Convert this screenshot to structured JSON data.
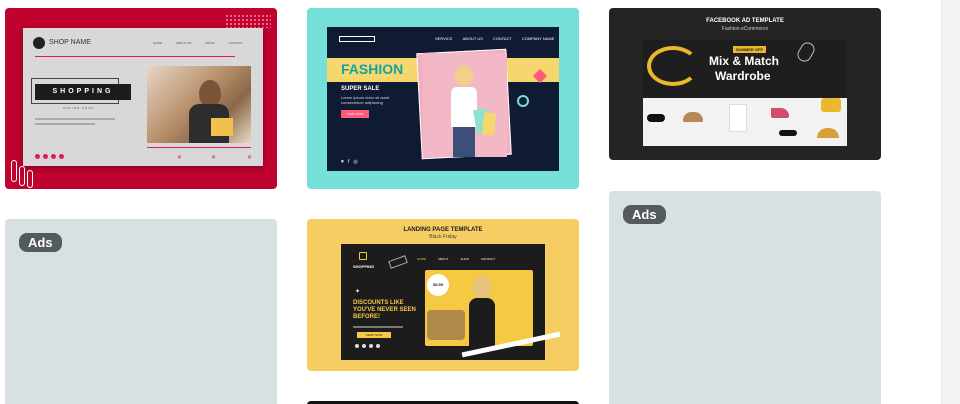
{
  "cards": {
    "shop": {
      "shop_name": "SHOP NAME",
      "nav": [
        "HOME",
        "ABOUT US",
        "PRICE",
        "CONTACT"
      ],
      "title": "SHOPPING",
      "subtitle": "ONLINE SHOP",
      "colors": {
        "frame": "#c0022f",
        "panel": "#d8d8d8",
        "accent": "#e01a4f"
      }
    },
    "fashion": {
      "nav": [
        "SERVICE",
        "ABOUT US",
        "CONTACT",
        "COMPANY NAME"
      ],
      "title": "FASHION",
      "sale": "SUPER SALE",
      "body": "Lorem ipsum dolor sit amet consectetuer adipiscing",
      "button": "SHOP NOW",
      "colors": {
        "frame": "#74e0d9",
        "panel": "#0f1b33",
        "band": "#f5d76e"
      }
    },
    "facebook": {
      "heading": "FACEBOOK AD TEMPLATE",
      "subheading": "Fashion eCommerce",
      "badge": "SUMMER OFF",
      "line1": "Mix & Match",
      "line2": "Wardrobe",
      "colors": {
        "frame": "#242424",
        "gold": "#e9b82c"
      }
    },
    "ads_left": {
      "label": "Ads"
    },
    "landing": {
      "heading": "LANDING PAGE TEMPLATE",
      "subheading": "Black Friday",
      "brand": "SHOPPING",
      "nav": [
        "HOME",
        "ABOUT",
        "SHOP",
        "CONTACT"
      ],
      "headline": "DISCOUNTS LIKE YOU'VE NEVER SEEN BEFORE!",
      "button": "SHOP NOW",
      "price": "$9.99",
      "colors": {
        "frame": "#f5cd62",
        "panel": "#1c1c1c",
        "accent": "#f6c945"
      }
    },
    "ads_right": {
      "label": "Ads"
    }
  }
}
